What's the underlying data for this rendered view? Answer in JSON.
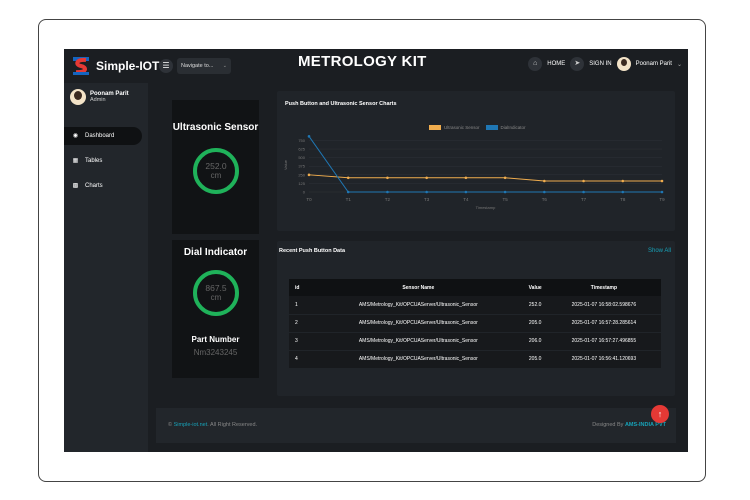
{
  "app": {
    "brand": "Simple-IOT",
    "title": "METROLOGY KIT",
    "nav_select": "Navigate to...",
    "home_label": "HOME",
    "signin_label": "SIGN IN",
    "user_name_top": "Poonam Parit"
  },
  "sidebar": {
    "user_name": "Poonam Parit",
    "user_role": "Admin",
    "items": [
      {
        "label": "Dashboard",
        "icon": "dashboard-icon",
        "active": true
      },
      {
        "label": "Tables",
        "icon": "table-icon",
        "active": false
      },
      {
        "label": "Charts",
        "icon": "chart-icon",
        "active": false
      }
    ]
  },
  "ultrasonic": {
    "title": "Ultrasonic Sensor",
    "value": "252.0",
    "unit": "cm"
  },
  "dial": {
    "title": "Dial Indicator",
    "value": "867.5",
    "unit": "cm",
    "part_label": "Part Number",
    "part_value": "Nm3243245"
  },
  "chart_panel": {
    "title": "Push Button and Ultrasonic Sensor Charts"
  },
  "chart_data": {
    "type": "line",
    "title": "Push Button and Ultrasonic Sensor Charts",
    "xlabel": "Timestamp",
    "ylabel": "Value",
    "categories": [
      "T0",
      "T1",
      "T2",
      "T3",
      "T4",
      "T5",
      "T6",
      "T7",
      "T8",
      "T9"
    ],
    "yticks": [
      "750",
      "625",
      "500",
      "375",
      "250",
      "125",
      "0"
    ],
    "ylim": [
      0,
      800
    ],
    "series": [
      {
        "name": "Ultrasonic Sensor",
        "color": "#f0ad4e",
        "values": [
          250,
          207,
          207,
          207,
          207,
          207,
          160,
          160,
          160,
          160
        ]
      },
      {
        "name": "DialIndicator",
        "color": "#1f77b4",
        "values": [
          810,
          0,
          0,
          0,
          0,
          0,
          0,
          0,
          0,
          0
        ]
      }
    ],
    "grid": true,
    "legend": "top-center"
  },
  "table": {
    "title": "Recent Push Button Data",
    "show_all": "Show All",
    "headers": [
      "id",
      "Sensor Name",
      "Value",
      "Timestamp"
    ],
    "rows": [
      [
        "1",
        "AMS/Metrology_Kit/OPCUAServer/Ultrasonic_Sensor",
        "252.0",
        "2025-01-07 16:58:02.598676"
      ],
      [
        "2",
        "AMS/Metrology_Kit/OPCUAServer/Ultrasonic_Sensor",
        "205.0",
        "2025-01-07 16:57:28.285614"
      ],
      [
        "3",
        "AMS/Metrology_Kit/OPCUAServer/Ultrasonic_Sensor",
        "206.0",
        "2025-01-07 16:57:27.496855"
      ],
      [
        "4",
        "AMS/Metrology_Kit/OPCUAServer/Ultrasonic_Sensor",
        "205.0",
        "2025-01-07 16:56:41.120693"
      ]
    ]
  },
  "footer": {
    "copyright_symbol": "©",
    "site_link": "Simple-iot.net",
    "rights": ". All Right Reserved.",
    "designed_by": "Designed By",
    "designer_link": "AMS-INDIA PVT"
  },
  "colors": {
    "accent": "#1fb25a",
    "link": "#17a2b8",
    "fab": "#e53935"
  }
}
